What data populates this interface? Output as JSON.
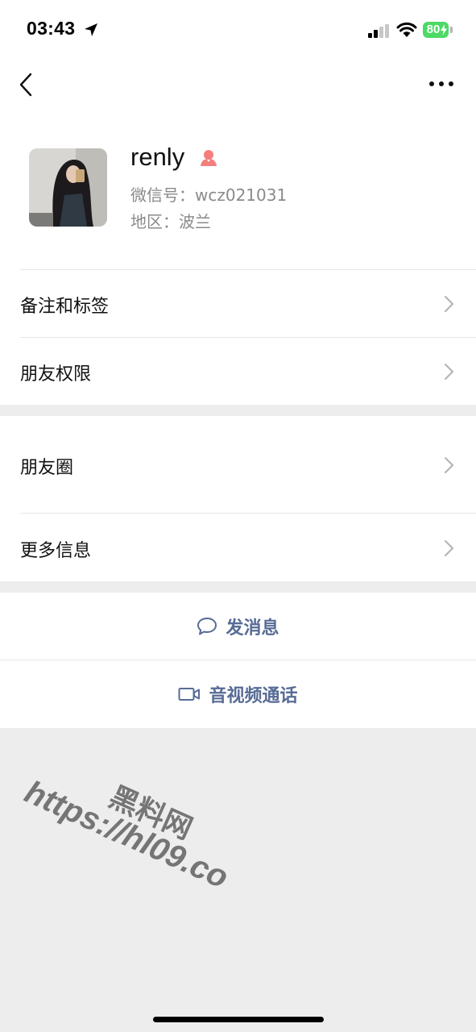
{
  "status_bar": {
    "time": "03:43",
    "battery": "80",
    "battery_color": "#4cd964"
  },
  "nav": {
    "back_icon": "chevron-left-icon",
    "more_icon": "more-dots-icon"
  },
  "profile": {
    "nickname": "renly",
    "gender": "female",
    "gender_color": "#f37e7d",
    "wechat_id_line": "微信号：wcz021031",
    "region_line": "地区：波兰"
  },
  "menu": {
    "remarks": "备注和标签",
    "permissions": "朋友权限",
    "moments": "朋友圈",
    "more_info": "更多信息"
  },
  "actions": {
    "send_message": "发消息",
    "av_call": "音视频通话",
    "link_color": "#576b95"
  },
  "watermark": {
    "line1": "黑料网",
    "line2": "https://hl09.co"
  }
}
